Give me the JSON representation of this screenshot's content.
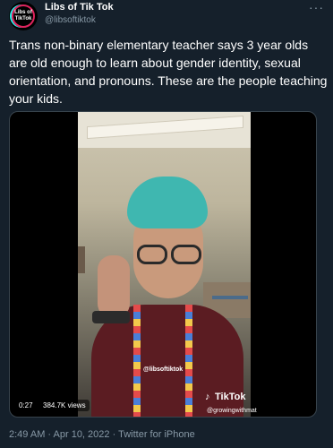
{
  "author": {
    "display_name": "Libs of Tik Tok",
    "handle": "@libsoftiktok",
    "avatar_text": "Libs of TikTok"
  },
  "tweet": {
    "text": "Trans non-binary elementary teacher says 3 year olds are old enough to learn about gender identity, sexual orientation, and pronouns. These are the people teaching your kids."
  },
  "media": {
    "watermark_handle": "@libsoftiktok",
    "tiktok_brand": "TikTok",
    "tiktok_user": "@growingwithmat",
    "duration": "0:27",
    "views": "384.7K views"
  },
  "footer": {
    "timestamp": "2:49 AM · Apr 10, 2022 · Twitter for iPhone"
  },
  "icons": {
    "more": "more-horizontal-icon",
    "tiktok": "tiktok-note-icon"
  },
  "colors": {
    "background": "#15202b",
    "secondary_text": "#8899a6"
  }
}
